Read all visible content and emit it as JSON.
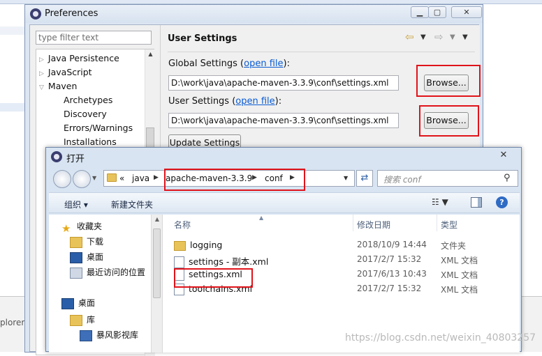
{
  "background": {
    "explorer_text": "plorer"
  },
  "preferences": {
    "title": "Preferences",
    "filter_placeholder": "type filter text",
    "tree": [
      {
        "label": "Java Persistence",
        "has_arrow": true,
        "indent": 0
      },
      {
        "label": "JavaScript",
        "has_arrow": true,
        "indent": 0
      },
      {
        "label": "Maven",
        "has_arrow": true,
        "indent": 0
      },
      {
        "label": "Archetypes",
        "has_arrow": false,
        "indent": 1
      },
      {
        "label": "Discovery",
        "has_arrow": false,
        "indent": 1
      },
      {
        "label": "Errors/Warnings",
        "has_arrow": false,
        "indent": 1
      },
      {
        "label": "Installations",
        "has_arrow": false,
        "indent": 1
      }
    ],
    "panel_title": "User Settings",
    "global": {
      "label": "Global Settings (",
      "link": "open file",
      "suffix": "):",
      "path": "D:\\work\\java\\apache-maven-3.3.9\\conf\\settings.xml",
      "browse": "Browse..."
    },
    "user": {
      "label": "User Settings (",
      "link": "open file",
      "suffix": "):",
      "path": "D:\\work\\java\\apache-maven-3.3.9\\conf\\settings.xml",
      "browse": "Browse..."
    },
    "update_button": "Update Settings"
  },
  "open_dialog": {
    "title": "打开",
    "breadcrumb": [
      "«",
      "java",
      "apache-maven-3.3.9",
      "conf"
    ],
    "search_placeholder": "搜索 conf",
    "organize": "组织 ▾",
    "new_folder": "新建文件夹",
    "help": "?",
    "nav": [
      {
        "label": "收藏夹",
        "icon": "star"
      },
      {
        "label": "下载",
        "icon": "download-folder"
      },
      {
        "label": "桌面",
        "icon": "desktop"
      },
      {
        "label": "最近访问的位置",
        "icon": "recent"
      },
      {
        "label": "桌面",
        "icon": "desktop"
      },
      {
        "label": "库",
        "icon": "library"
      },
      {
        "label": "暴风影视库",
        "icon": "film"
      }
    ],
    "columns": {
      "name": "名称",
      "date": "修改日期",
      "type": "类型"
    },
    "files": [
      {
        "name": "logging",
        "date": "2018/10/9 14:44",
        "type": "文件夹",
        "icon": "folder"
      },
      {
        "name": "settings - 副本.xml",
        "date": "2017/2/7 15:32",
        "type": "XML 文档",
        "icon": "xml"
      },
      {
        "name": "settings.xml",
        "date": "2017/6/13 10:43",
        "type": "XML 文档",
        "icon": "xml"
      },
      {
        "name": "toolchains.xml",
        "date": "2017/2/7 15:32",
        "type": "XML 文档",
        "icon": "xml"
      }
    ]
  },
  "watermark": "https://blog.csdn.net/weixin_40803257"
}
